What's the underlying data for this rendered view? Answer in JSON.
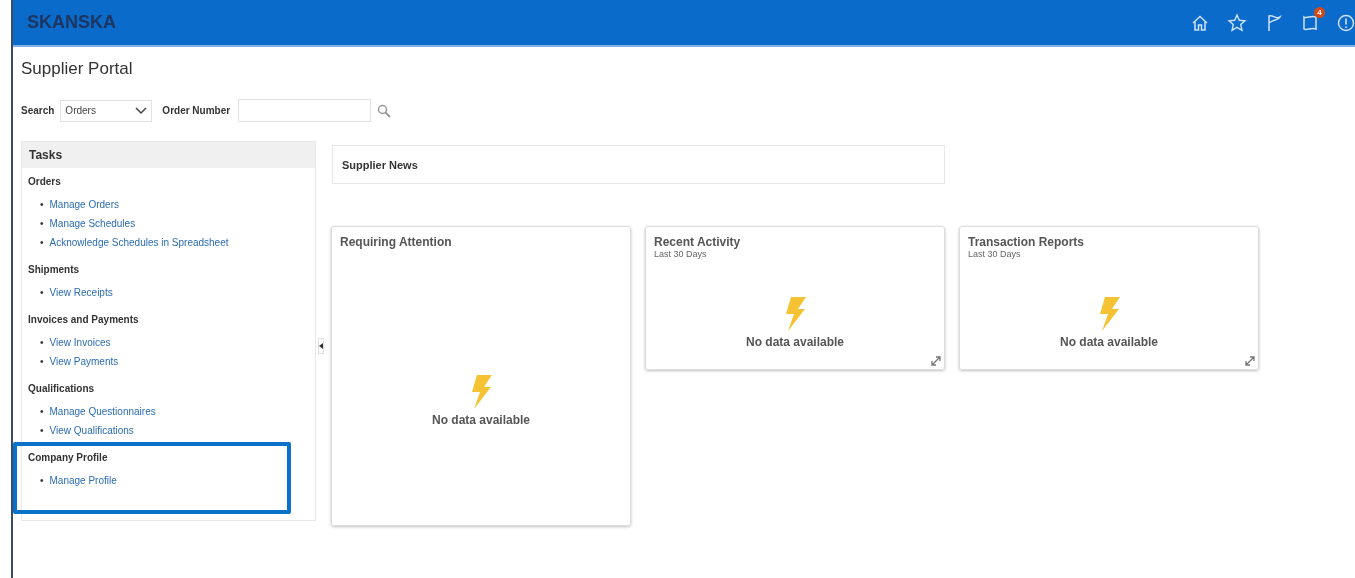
{
  "header": {
    "logo": "SKANSKA",
    "notification_count": "4"
  },
  "page_title": "Supplier Portal",
  "search": {
    "label": "Search",
    "category": "Orders",
    "field_label": "Order Number"
  },
  "tasks": {
    "title": "Tasks",
    "bullet": "•",
    "sections": [
      {
        "title": "Orders",
        "highlighted": false,
        "links": [
          "Manage Orders",
          "Manage Schedules",
          "Acknowledge Schedules in Spreadsheet"
        ]
      },
      {
        "title": "Shipments",
        "highlighted": false,
        "links": [
          "View Receipts"
        ]
      },
      {
        "title": "Invoices and Payments",
        "highlighted": false,
        "links": [
          "View Invoices",
          "View Payments"
        ]
      },
      {
        "title": "Qualifications",
        "highlighted": false,
        "links": [
          "Manage Questionnaires",
          "View Qualifications"
        ]
      },
      {
        "title": "Company Profile",
        "highlighted": true,
        "links": [
          "Manage Profile"
        ]
      }
    ]
  },
  "news": {
    "title": "Supplier News"
  },
  "cards": [
    {
      "title": "Requiring Attention",
      "message": "No data available",
      "tall": true
    },
    {
      "title": "Recent Activity",
      "subtitle": "Last 30 Days",
      "message": "No data available",
      "tall": false
    },
    {
      "title": "Transaction Reports",
      "subtitle": "Last 30 Days",
      "message": "No data available",
      "tall": false
    }
  ]
}
